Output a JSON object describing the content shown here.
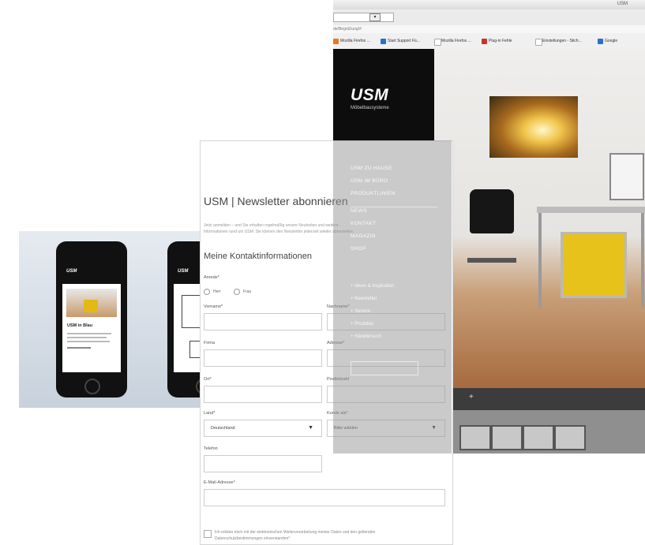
{
  "browser": {
    "window_title": "USM",
    "address_value": "",
    "url_text": "de/Begrüßung/#",
    "bookmarks": [
      {
        "label": "Mozilla Firefox ...",
        "color": "#e87722"
      },
      {
        "label": "Start Support Fü...",
        "color": "#2a6fc9"
      },
      {
        "label": "Mozilla Firefox ...",
        "color": "#cccccc"
      },
      {
        "label": "Plug-in Fehle",
        "color": "#c0392b"
      },
      {
        "label": "Einstellungen - Stich...",
        "color": "#cccccc"
      },
      {
        "label": "Google",
        "color": "#2a6fc9"
      }
    ]
  },
  "site": {
    "logo": "USM",
    "logo_sub": "Möbelbausysteme",
    "nav": [
      "USM ZU HAUSE",
      "USM IM BÜRO",
      "PRODUKTLINIEN",
      "NEWS",
      "KONTAKT",
      "MAGAZIN",
      "SHOP"
    ],
    "subnav": [
      "Ideen & Inspiration",
      "Newsletter",
      "Service",
      "Produkte",
      "Händlersuch"
    ]
  },
  "phones": {
    "logo": "USM",
    "headline": "USM in Blau"
  },
  "form": {
    "title": "USM | Newsletter abonnieren",
    "intro_lines": [
      "Jetzt anmelden – und Sie erhalten regelmäßig unsere Neuheiten und weitere",
      "Informationen rund um USM. Sie können den Newsletter jederzeit wieder abbestellen."
    ],
    "section_title": "Meine Kontaktinformationen",
    "anrede_label": "Anrede*",
    "radio_options": [
      "Herr",
      "Frau"
    ],
    "vorname_label": "Vorname*",
    "nachname_label": "Nachname*",
    "firma_label": "Firma",
    "adresse_label": "Adresse*",
    "ort_label": "Ort*",
    "postleitzahl_label": "Postleitzahl",
    "land_label": "Land*",
    "land_value": "Deutschland",
    "kunde_label": "Kunde als*",
    "kunde_value": "Bitte wählen",
    "telefon_label": "Telefon",
    "email_label": "E-Mail-Adresse*",
    "consent_line1": "Ich erkläre mich mit der elektronischen Weiterverarbeitung meiner Daten und den geltenden",
    "consent_line2": "Datenschutzbestimmungen einverstanden*"
  }
}
